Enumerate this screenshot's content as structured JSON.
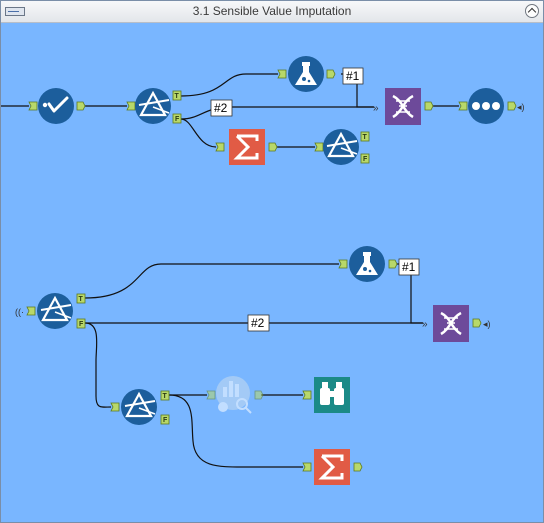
{
  "window": {
    "title": "3.1 Sensible Value Imputation"
  },
  "labels": {
    "true": "T",
    "false": "F",
    "input1": "#1",
    "input2": "#2"
  },
  "tools": {
    "select": "select-tool",
    "filter": "filter-tool",
    "formula": "formula-tool",
    "summarize": "summarize-tool",
    "join_multiple": "join-multiple-tool",
    "browse": "browse-tool",
    "macro_input": "macro-input-tool",
    "macro_output": "macro-output-tool",
    "field_summary": "field-summary-tool"
  },
  "colors": {
    "canvas": "#79b6ff",
    "blue_tool": "#1c5e9c",
    "join_tool": "#6d4a9a",
    "summarize_tool": "#e15b45",
    "browse_tool": "#1b8a87",
    "anchor": "#b8d86a"
  }
}
